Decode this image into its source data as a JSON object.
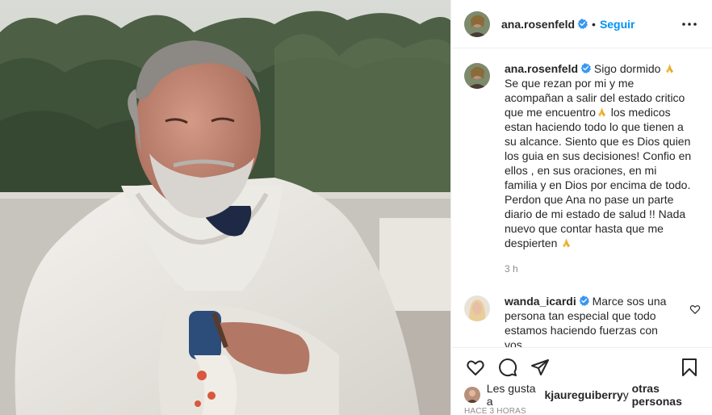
{
  "post": {
    "author": "ana.rosenfeld",
    "follow_label": "Seguir",
    "separator": "•"
  },
  "caption": {
    "username": "ana.rosenfeld",
    "text_1": "Sigo dormido ",
    "text_2": " Se que rezan por mi y me acompañan a salir del estado critico que me encuentro",
    "text_3": " los medicos estan haciendo todo lo que tienen a su alcance. Siento que es Dios quien los guia en sus decisiones! Confio en ellos , en sus oraciones, en mi familia y en Dios por encima de todo. Perdon que Ana no pase un parte diario de mi estado de salud !! Nada nuevo que contar hasta que me despierten ",
    "time": "3 h"
  },
  "reply": {
    "username": "wanda_icardi",
    "text": " Marce sos una persona tan especial que todo estamos haciendo fuerzas con vos"
  },
  "likes": {
    "prefix": "Les gusta a ",
    "user": "kjaureguiberry",
    "middle": " y ",
    "others": "otras personas"
  },
  "timestamp": "HACE 3 HORAS",
  "icons": {
    "more": "more-options-icon",
    "like": "heart-icon",
    "comment": "comment-bubble-icon",
    "share": "paper-plane-icon",
    "save": "bookmark-icon",
    "verified": "verified-badge-icon",
    "pray": "folded-hands-emoji",
    "red_heart": "red-heart-emoji"
  },
  "colors": {
    "accent": "#0095f6",
    "text": "#262626",
    "muted": "#8e8e8e",
    "heart": "#ed4956"
  }
}
